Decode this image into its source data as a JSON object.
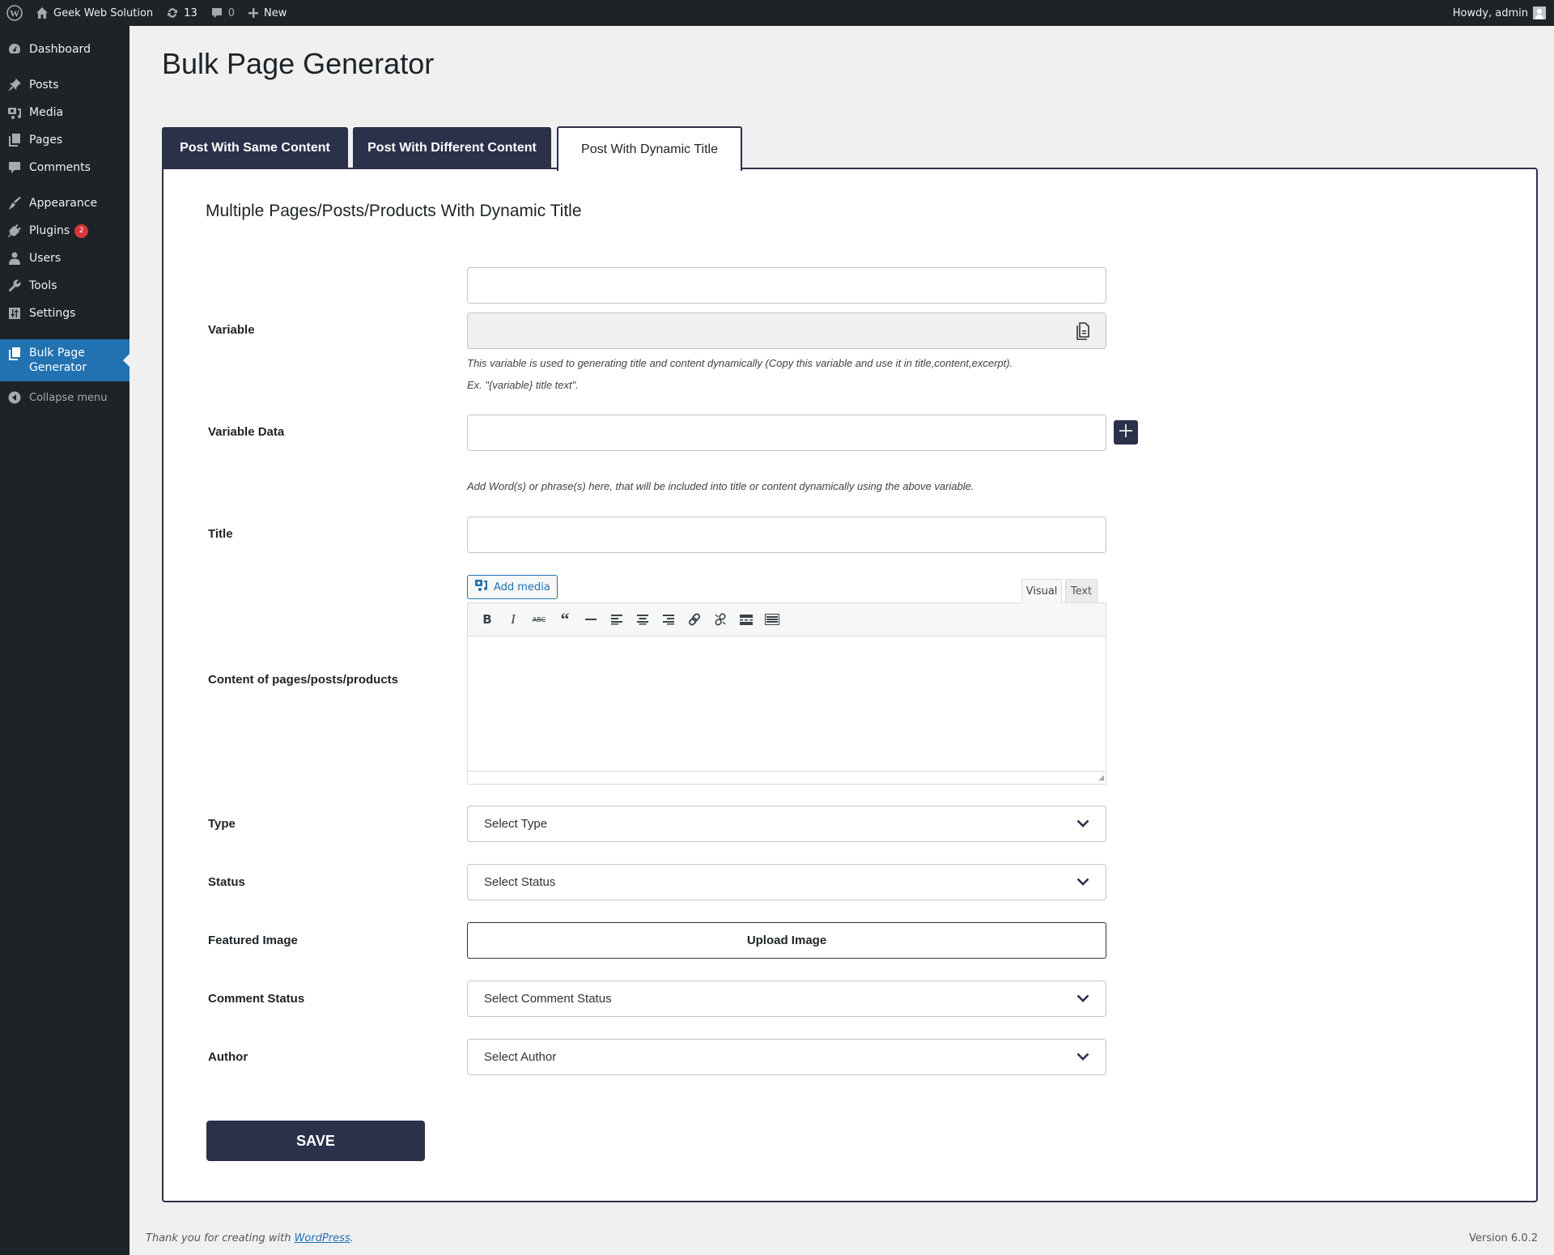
{
  "adminbar": {
    "site_name": "Geek Web Solution",
    "updates_count": "13",
    "comments_count": "0",
    "new_label": "New",
    "greeting": "Howdy, admin"
  },
  "sidebar": {
    "items": [
      {
        "label": "Dashboard",
        "icon": "dashboard-icon"
      },
      {
        "label": "Posts",
        "icon": "pin-icon"
      },
      {
        "label": "Media",
        "icon": "media-icon"
      },
      {
        "label": "Pages",
        "icon": "pages-icon"
      },
      {
        "label": "Comments",
        "icon": "comment-icon"
      },
      {
        "label": "Appearance",
        "icon": "brush-icon"
      },
      {
        "label": "Plugins",
        "icon": "plugin-icon",
        "badge": "2"
      },
      {
        "label": "Users",
        "icon": "user-icon"
      },
      {
        "label": "Tools",
        "icon": "wrench-icon"
      },
      {
        "label": "Settings",
        "icon": "settings-icon"
      },
      {
        "label": "Bulk Page Generator",
        "icon": "pages-icon",
        "current": true
      }
    ],
    "collapse_label": "Collapse menu"
  },
  "page": {
    "title": "Bulk Page Generator",
    "tabs": [
      {
        "label": "Post With Same Content",
        "active": false
      },
      {
        "label": "Post With Different Content",
        "active": false
      },
      {
        "label": "Post With Dynamic Title",
        "active": true
      }
    ]
  },
  "form": {
    "heading": "Multiple Pages/Posts/Products With Dynamic Title",
    "variable": {
      "label": "Variable",
      "value": "",
      "generated_value": "",
      "help_1": "This variable is used to generating title and content dynamically (Copy this variable and use it in title,content,excerpt).",
      "help_2": "Ex. \"{variable} title text\"."
    },
    "variable_data": {
      "label": "Variable Data",
      "value": "",
      "help": "Add Word(s) or phrase(s) here, that will be included into title or content dynamically using the above variable."
    },
    "title": {
      "label": "Title",
      "value": ""
    },
    "content": {
      "label": "Content of pages/posts/products",
      "add_media": "Add media",
      "tab_visual": "Visual",
      "tab_text": "Text",
      "toolbar": [
        "bold",
        "italic",
        "strikethrough",
        "blockquote",
        "horizontal-rule",
        "align-left",
        "align-center",
        "align-right",
        "link",
        "unlink",
        "read-more",
        "toolbar-toggle"
      ]
    },
    "type": {
      "label": "Type",
      "selected": "Select Type"
    },
    "status": {
      "label": "Status",
      "selected": "Select Status"
    },
    "featured_image": {
      "label": "Featured Image",
      "button": "Upload Image"
    },
    "comment_status": {
      "label": "Comment Status",
      "selected": "Select Comment Status"
    },
    "author": {
      "label": "Author",
      "selected": "Select Author"
    },
    "save_label": "SAVE"
  },
  "footer": {
    "thanks_prefix": "Thank you for creating with ",
    "thanks_link": "WordPress",
    "thanks_suffix": ".",
    "version": "Version 6.0.2"
  },
  "colors": {
    "brand_navy": "#2b314b",
    "wp_blue": "#2271b1",
    "admin_dark": "#1d2327"
  }
}
